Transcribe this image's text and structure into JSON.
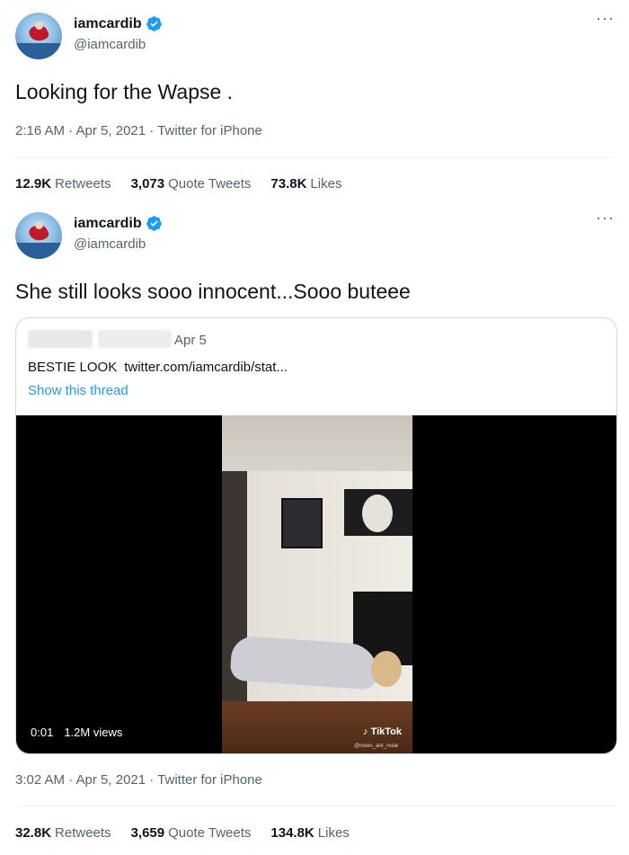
{
  "tweet1": {
    "display_name": "iamcardib",
    "handle": "@iamcardib",
    "text": "Looking for the Wapse .",
    "meta": "2:16 AM · Apr 5, 2021 · Twitter for iPhone",
    "stats": [
      {
        "value": "12.9K",
        "label": "Retweets"
      },
      {
        "value": "3,073",
        "label": "Quote Tweets"
      },
      {
        "value": "73.8K",
        "label": "Likes"
      }
    ]
  },
  "tweet2": {
    "display_name": "iamcardib",
    "handle": "@iamcardib",
    "text": "She still looks sooo innocent...Sooo buteee",
    "quote": {
      "date": "Apr 5",
      "text": "BESTIE LOOK",
      "link": "twitter.com/iamcardib/stat...",
      "show_thread": "Show this thread",
      "video": {
        "time": "0:01",
        "views": "1.2M views",
        "watermark": "TikTok",
        "watermark_user": "@roses_are_rosie"
      }
    },
    "meta": "3:02 AM · Apr 5, 2021 · Twitter for iPhone",
    "stats": [
      {
        "value": "32.8K",
        "label": "Retweets"
      },
      {
        "value": "3,659",
        "label": "Quote Tweets"
      },
      {
        "value": "134.8K",
        "label": "Likes"
      }
    ]
  },
  "icons": {
    "more": "more-horizontal-icon",
    "verified": "verified-badge-icon",
    "tiktok": "tiktok-logo-icon"
  },
  "colors": {
    "verified_blue": "#1d9bf0",
    "secondary_text": "#536471",
    "link": "#1d9bf0"
  }
}
